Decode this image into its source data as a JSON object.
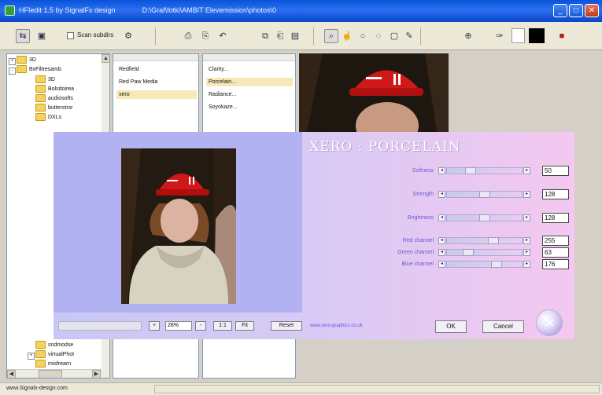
{
  "window": {
    "title": "HFIedit 1.5 by SignalFx design",
    "path": "D:\\Graf\\fotki\\AMBIT Elevemission\\photos\\0",
    "minimize": "_",
    "maximize": "□",
    "close": "✕"
  },
  "toolbar": {
    "scan_label": "Scan subdirs",
    "icons": [
      "open-folder-icon",
      "folder-icon",
      "settings-icon",
      "print-icon",
      "print-preview-icon",
      "undo-icon",
      "copy-icon",
      "paste-icon",
      "save-icon",
      "zoom-icon",
      "pointer-icon",
      "circle-select-icon",
      "lasso-icon",
      "rect-select-icon",
      "pen-icon",
      "hand-icon",
      "picker-icon",
      "info-icon"
    ],
    "color_white": "#ffffff",
    "color_black": "#000000"
  },
  "tree": {
    "items": [
      {
        "label": "3D"
      },
      {
        "label": "BxFiltresamb"
      },
      {
        "label": "3D"
      },
      {
        "label": "Bolsdoirea"
      },
      {
        "label": "audiosofts"
      },
      {
        "label": "butterstrsr"
      },
      {
        "label": "DXLs"
      }
    ],
    "bottom_items": [
      {
        "label": "sndmodse"
      },
      {
        "label": "virtualPhot"
      },
      {
        "label": "misfrearn"
      }
    ]
  },
  "vendors": {
    "items": [
      "Redfield",
      "Red Paw Media",
      "xero"
    ],
    "selected": 2
  },
  "filters": {
    "items": [
      "Clarity...",
      "Porcelain...",
      "Radiance...",
      "Soyokaze..."
    ],
    "selected": 1
  },
  "dialog": {
    "heading": "XERO : PORCELAIN",
    "sliders": [
      {
        "label": "Softness",
        "value": "50",
        "fraction": 0.28
      },
      {
        "label": "Strength",
        "value": "128",
        "fraction": 0.5
      },
      {
        "label": "Brightness",
        "value": "128",
        "fraction": 0.5
      },
      {
        "label": "Red channel",
        "value": "255",
        "fraction": 0.64
      },
      {
        "label": "Green channel",
        "value": "63",
        "fraction": 0.25
      },
      {
        "label": "Blue channel",
        "value": "176",
        "fraction": 0.69
      }
    ],
    "zoom": {
      "plus": "+",
      "minus": "-",
      "value": "28%",
      "one_to_one": "1:1",
      "fit": "Fit"
    },
    "reset": "Reset",
    "website": "www.xero-graphics.co.uk",
    "ok": "OK",
    "cancel": "Cancel",
    "colors": {
      "label": "#6a5ad0",
      "heading": "#ffffff"
    }
  },
  "status": {
    "text": "www.Signalx-design.com"
  }
}
